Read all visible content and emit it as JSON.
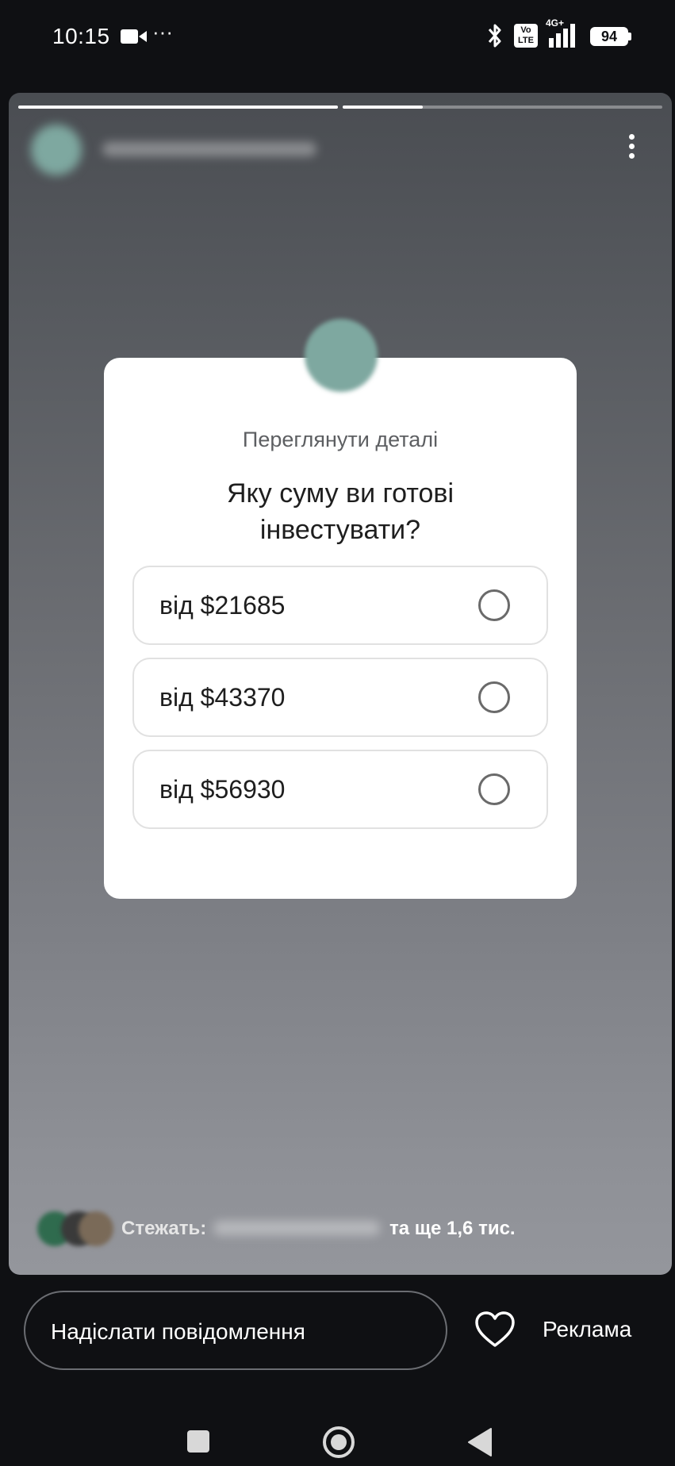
{
  "status_bar": {
    "time": "10:15",
    "network_label": "4G+",
    "volte_label": "Vo LTE",
    "battery": "94"
  },
  "story": {
    "progress": [
      1.0,
      0.25
    ],
    "card": {
      "subtitle": "Переглянути деталі",
      "question": "Яку суму ви готові інвестувати?",
      "options": [
        {
          "label": "від $21685"
        },
        {
          "label": "від $43370"
        },
        {
          "label": "від $56930"
        }
      ]
    },
    "followers": {
      "label": "Стежать:",
      "more": "та ще 1,6 тис."
    }
  },
  "bottom_bar": {
    "message_placeholder": "Надіслати повідомлення",
    "ad_label": "Реклама"
  },
  "icons": {
    "status": [
      "video-camera-icon",
      "more-dots-icon",
      "bluetooth-icon",
      "volte-icon",
      "signal-icon",
      "battery-icon"
    ],
    "story": [
      "more-vertical-icon",
      "radio-icon"
    ],
    "bottom": [
      "heart-icon"
    ],
    "nav": [
      "recents-icon",
      "home-icon",
      "back-icon"
    ]
  },
  "colors": {
    "background": "#0f1013",
    "card": "#ffffff",
    "avatar_teal": "#7ea8a0"
  }
}
